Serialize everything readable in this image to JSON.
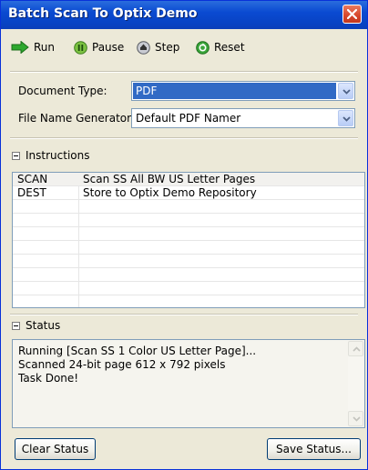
{
  "window": {
    "title": "Batch Scan To Optix Demo"
  },
  "toolbar": {
    "run_label": "Run",
    "pause_label": "Pause",
    "step_label": "Step",
    "reset_label": "Reset"
  },
  "form": {
    "document_type_label": "Document Type:",
    "document_type_value": "PDF",
    "file_name_generator_label": "File Name Generator:",
    "file_name_generator_value": "Default PDF Namer"
  },
  "instructions": {
    "header": "Instructions",
    "rows": [
      {
        "code": "SCAN",
        "desc": "Scan SS All BW US Letter Pages"
      },
      {
        "code": "DEST",
        "desc": "Store to Optix Demo Repository"
      }
    ]
  },
  "status": {
    "header": "Status",
    "lines": [
      "Running [Scan SS 1 Color US Letter Page]...",
      "Scanned 24-bit page 612 x 792 pixels",
      "Task Done!"
    ]
  },
  "buttons": {
    "clear_status": "Clear Status",
    "save_status": "Save Status..."
  },
  "colors": {
    "titlebar": "#0a4ad1",
    "selection": "#316ac5",
    "run_icon": "#2ea82e",
    "pause_icon": "#7cc242",
    "reset_icon": "#3aa53a"
  },
  "icons": {
    "run": "green-arrow-icon",
    "pause": "pause-icon",
    "step": "step-icon",
    "reset": "reset-icon",
    "close": "close-icon"
  }
}
